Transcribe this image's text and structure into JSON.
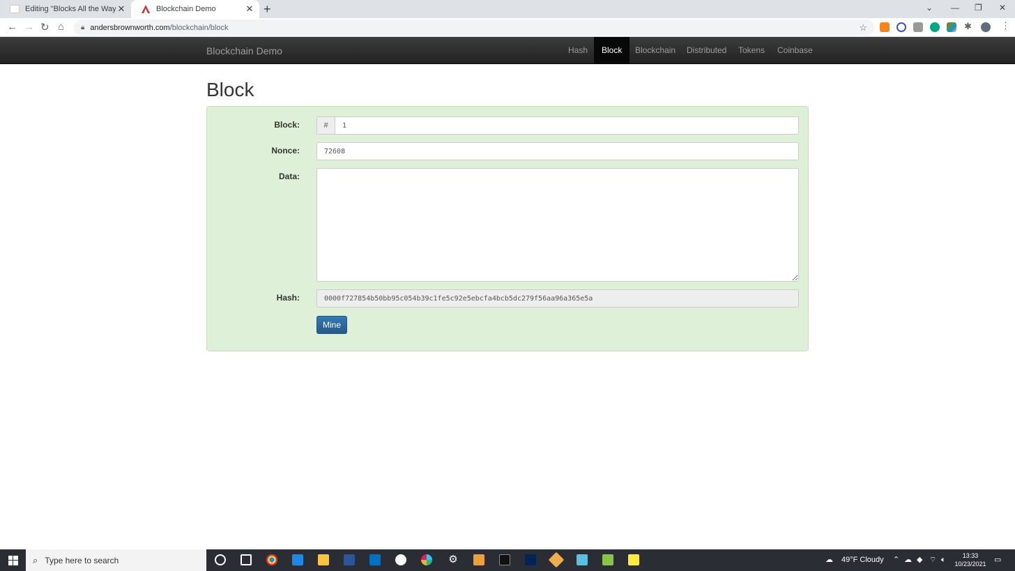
{
  "browser": {
    "tabs": [
      {
        "title": "Editing \"Blocks All the Way Down\"",
        "active": false
      },
      {
        "title": "Blockchain Demo",
        "active": true
      }
    ],
    "url_host": "andersbrownworth.com",
    "url_path": "/blockchain/block"
  },
  "site": {
    "brand": "Blockchain Demo",
    "nav": [
      "Hash",
      "Block",
      "Blockchain",
      "Distributed",
      "Tokens",
      "Coinbase"
    ],
    "active_nav": "Block"
  },
  "page": {
    "title": "Block",
    "form": {
      "block_label": "Block:",
      "block_addon": "#",
      "block_value": "1",
      "nonce_label": "Nonce:",
      "nonce_value": "72608",
      "data_label": "Data:",
      "data_value": "",
      "hash_label": "Hash:",
      "hash_value": "0000f727854b50bb95c054b39c1fe5c92e5ebcfa4bcb5dc279f56aa96a365e5a",
      "mine_label": "Mine"
    },
    "card_color": "#dff0d8"
  },
  "taskbar": {
    "search_placeholder": "Type here to search",
    "weather": "49°F  Cloudy",
    "time": "13:33",
    "date": "10/23/2021"
  }
}
